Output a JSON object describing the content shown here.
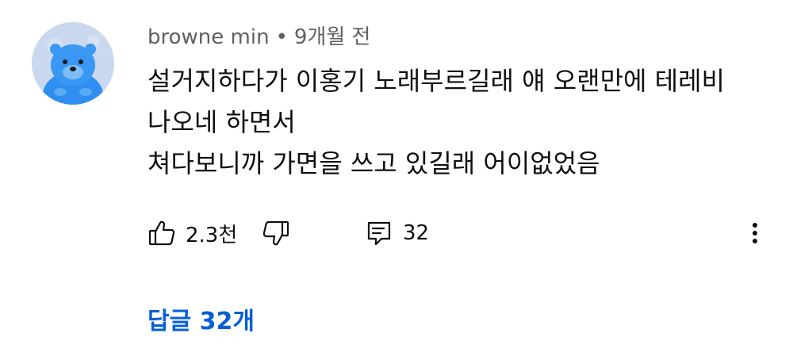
{
  "comment": {
    "author": "browne min",
    "separator": "•",
    "time": "9개월 전",
    "lines": [
      "설거지하다가 이홍기 노래부르길래 얘 오랜만에 테레비",
      "나오네 하면서",
      "쳐다보니까 가면을 쓰고 있길래 어이없었음"
    ],
    "likes": "2.3천",
    "reply_count": "32",
    "replies_label": "답글 32개"
  },
  "icons": {
    "like": "thumbs-up-icon",
    "dislike": "thumbs-down-icon",
    "reply": "comment-icon",
    "more": "more-vertical-icon"
  },
  "colors": {
    "text": "#0f0f0f",
    "meta": "#606060",
    "link": "#065fd4",
    "avatar_bg": "#c9d8ef",
    "avatar_char": "#2f8ef0"
  }
}
